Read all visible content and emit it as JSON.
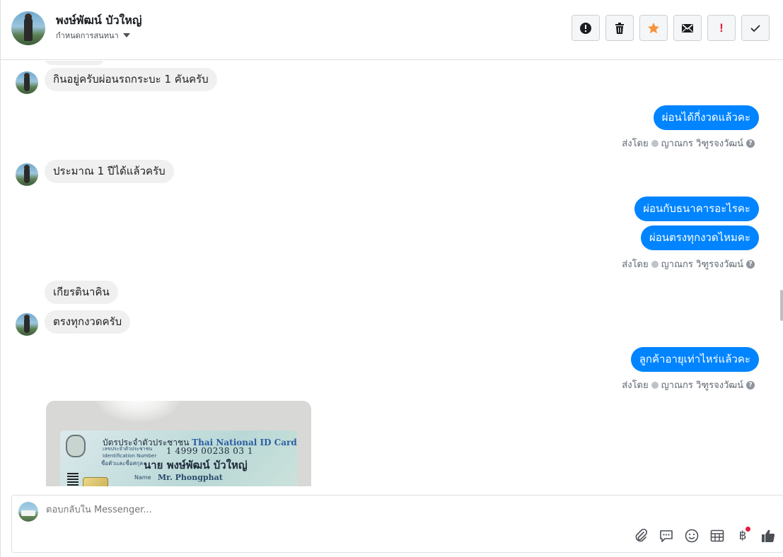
{
  "header": {
    "contact_name": "พงษ์พัฒน์ บัวใหญ่",
    "conversation_settings": "กำหนดการสนทนา",
    "toolbar": [
      {
        "name": "spam-button",
        "icon": "alert-circle-icon"
      },
      {
        "name": "delete-button",
        "icon": "trash-icon"
      },
      {
        "name": "star-button",
        "icon": "star-icon"
      },
      {
        "name": "mark-unread-button",
        "icon": "envelope-icon"
      },
      {
        "name": "follow-up-button",
        "icon": "exclamation-icon"
      },
      {
        "name": "mark-done-button",
        "icon": "check-icon"
      }
    ]
  },
  "messages": {
    "m1": "กินอยู่ครับผ่อนรถกระบะ 1 คันครับ",
    "m2": "ผ่อนได้กี่งวดแล้วคะ",
    "m3": "ประมาณ 1 ปีได้แล้วครับ",
    "m4": "ผ่อนกับธนาคารอะไรคะ",
    "m5": "ผ่อนตรงทุกงวดไหมคะ",
    "m6": "เกียรตินาคิน",
    "m7": "ตรงทุกงวดครับ",
    "m8": "ลูกค้าอายุเท่าไหร่แล้วคะ"
  },
  "sent_by": {
    "label": "ส่งโดย",
    "agent": "ญาณกร วิฑูรจงวัฒน์"
  },
  "id_card": {
    "title_th": "บัตรประจำตัวประชาชน",
    "title_en": "Thai National ID Card",
    "id_label_th": "เลขประจำตัวประชาชน",
    "id_label_en": "Identification Number",
    "id_number": "1 4999 00238 03 1",
    "name_label": "ชื่อตัวและชื่อสกุล",
    "name_th": "นาย พงษ์พัฒน์ บัวใหญ่",
    "name_label_en": "Name",
    "name_en": "Mr. Phongphat"
  },
  "composer": {
    "placeholder": "ตอบกลับใน Messenger...",
    "tools": [
      "paperclip-icon",
      "saved-reply-icon",
      "emoji-icon",
      "table-icon",
      "baht-icon",
      "thumbs-up-icon"
    ],
    "baht_symbol": "฿"
  },
  "colors": {
    "outgoing_bubble": "#0084ff",
    "incoming_bubble": "#f1f0f0",
    "star": "#f7923b",
    "alert": "#e41e3f"
  }
}
